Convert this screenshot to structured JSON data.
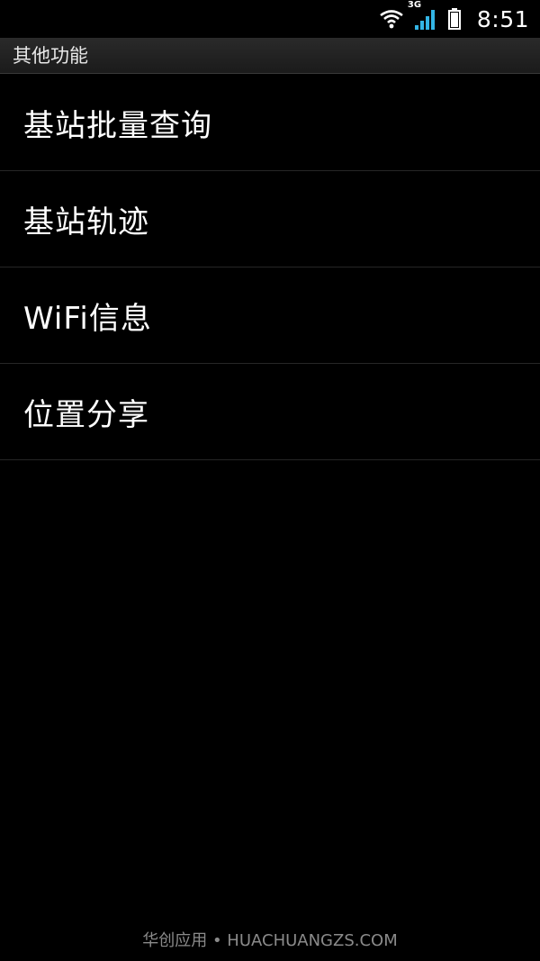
{
  "status_bar": {
    "time": "8:51",
    "network_type": "3G",
    "icons": [
      "wifi-icon",
      "signal-icon",
      "battery-icon"
    ]
  },
  "title_bar": {
    "title": "其他功能"
  },
  "menu": {
    "items": [
      {
        "label": "基站批量查询"
      },
      {
        "label": "基站轨迹"
      },
      {
        "label": "WiFi信息"
      },
      {
        "label": "位置分享"
      }
    ]
  },
  "footer": {
    "watermark": "华创应用 • HUACHUANGZS.COM"
  },
  "colors": {
    "background": "#000000",
    "title_bar": "#222222",
    "signal_accent": "#33b5e5",
    "text": "#ffffff"
  }
}
